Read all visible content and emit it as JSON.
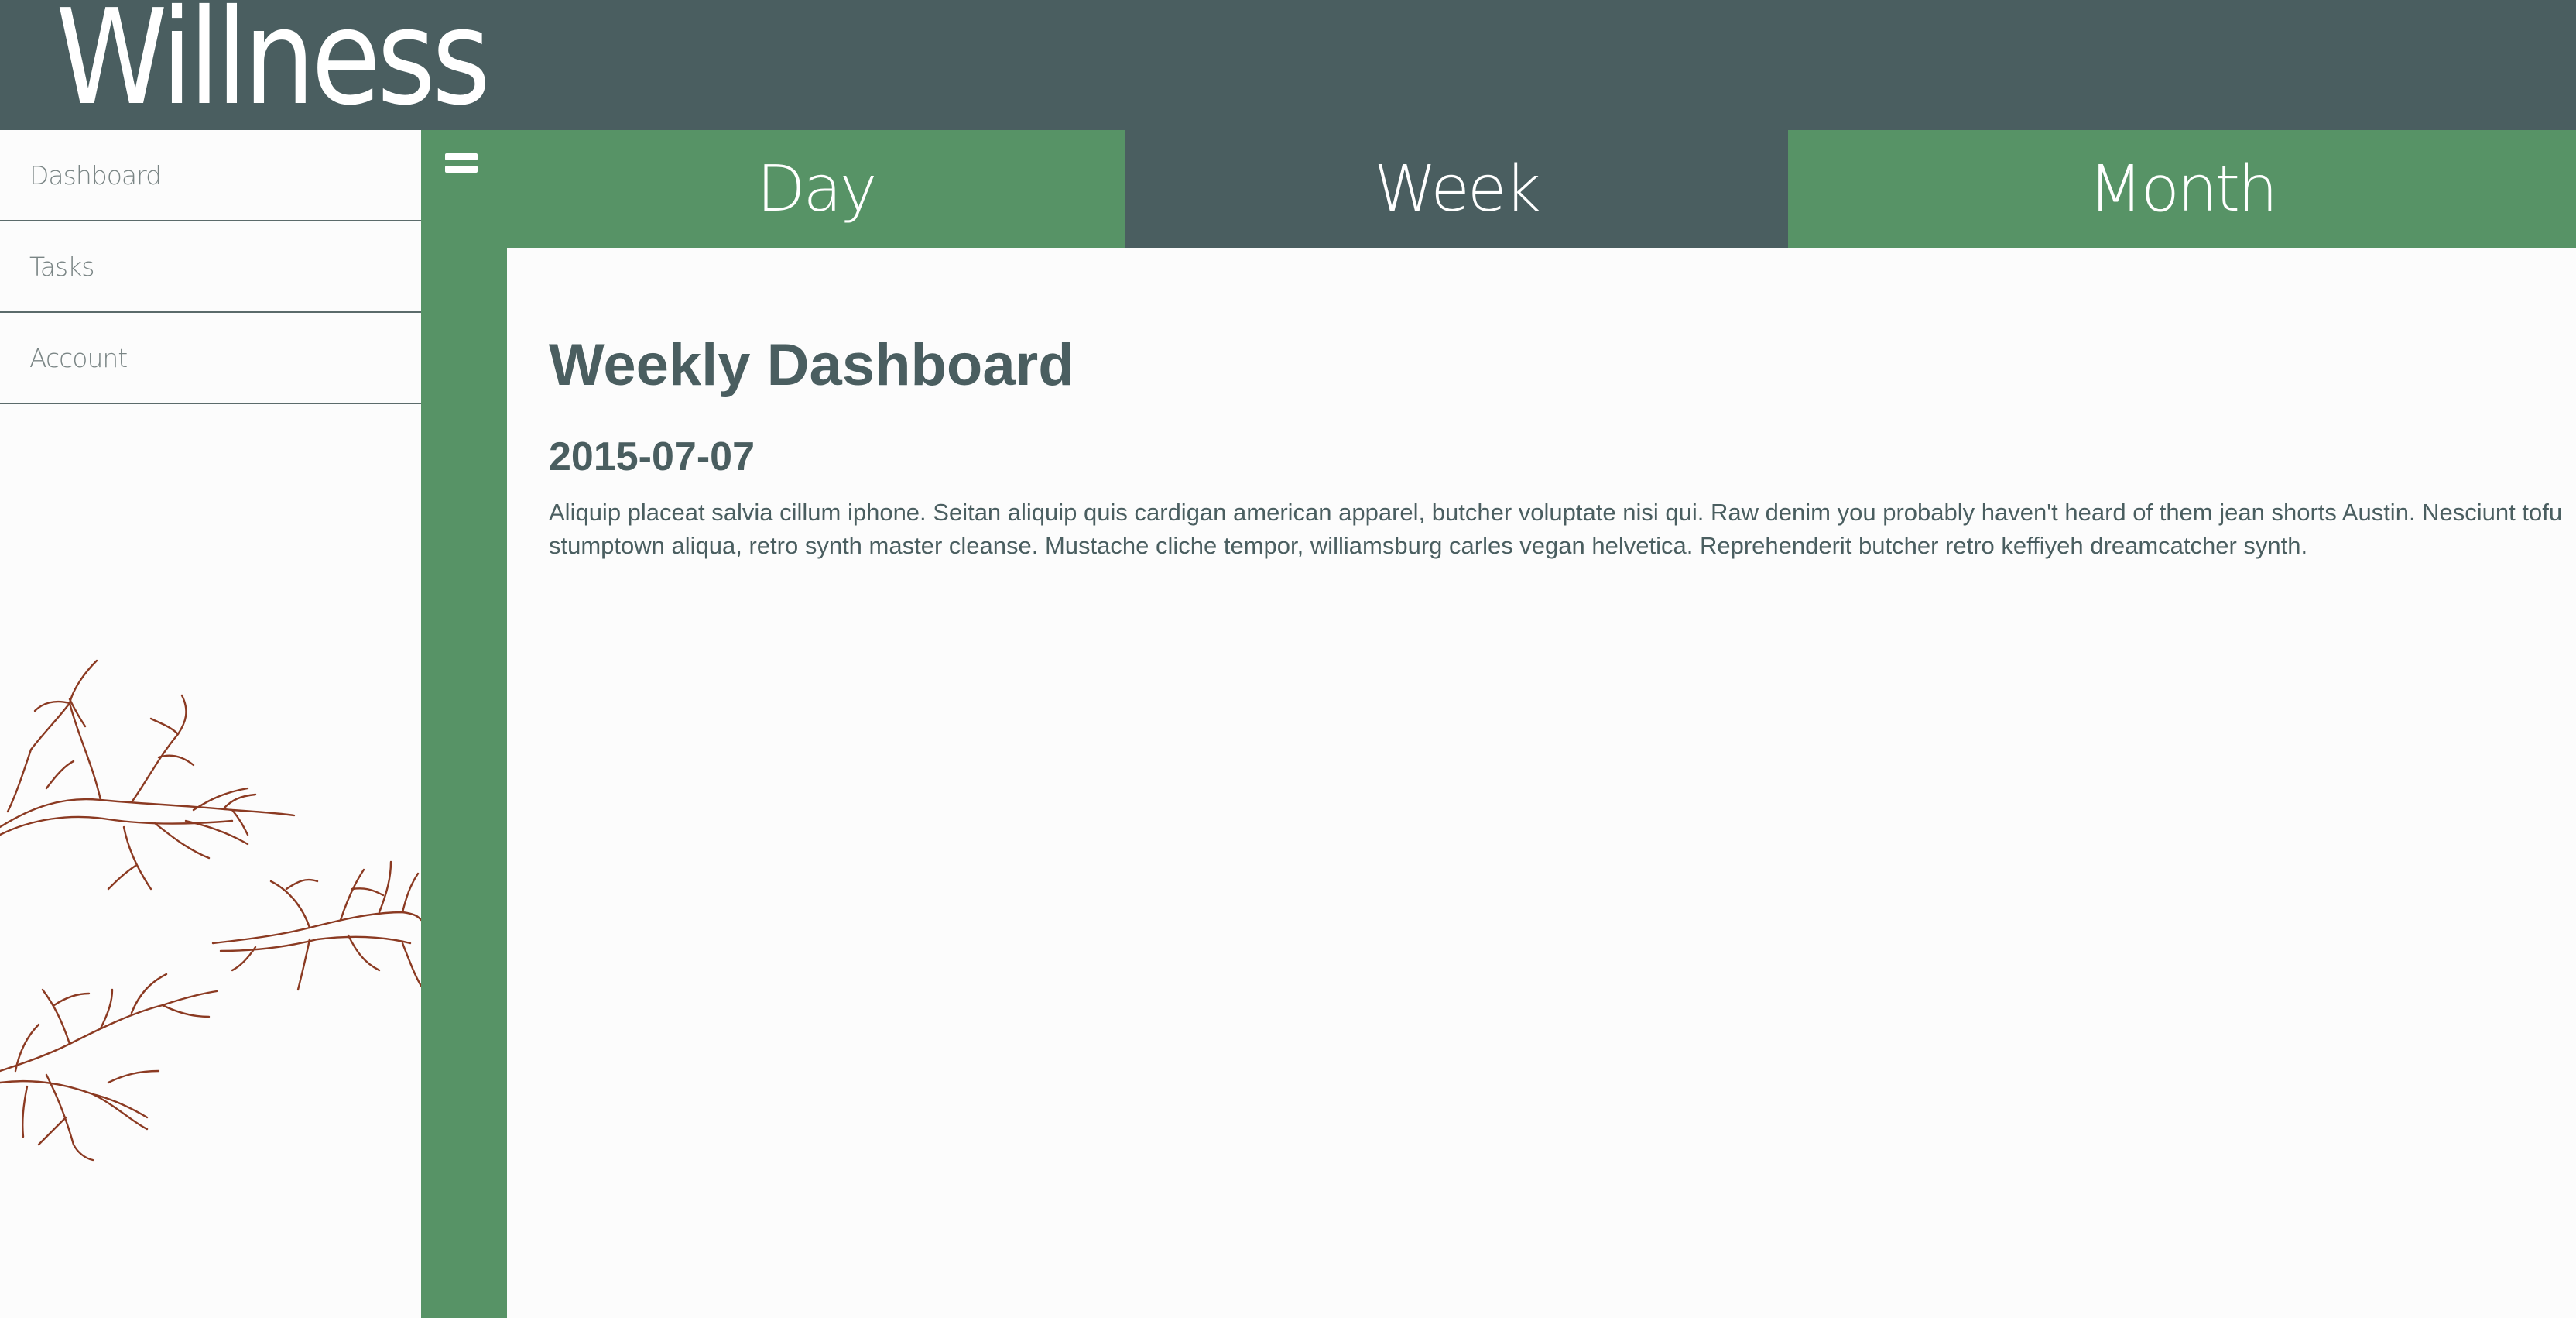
{
  "app": {
    "logo": "Willness"
  },
  "sidebar": {
    "items": [
      {
        "label": "Dashboard"
      },
      {
        "label": "Tasks"
      },
      {
        "label": "Account"
      }
    ]
  },
  "tabs": [
    {
      "label": "Day",
      "active": false
    },
    {
      "label": "Week",
      "active": true
    },
    {
      "label": "Month",
      "active": false
    }
  ],
  "main": {
    "title": "Weekly Dashboard",
    "date": "2015-07-07",
    "body": "Aliquip placeat salvia cillum iphone. Seitan aliquip quis cardigan american apparel, butcher voluptate nisi qui. Raw denim you probably haven't heard of them jean shorts Austin. Nesciunt tofu stumptown aliqua, retro synth master cleanse. Mustache cliche tempor, williamsburg carles vegan helvetica. Reprehenderit butcher retro keffiyeh dreamcatcher synth."
  },
  "colors": {
    "header": "#4a5e60",
    "green": "#579366",
    "branch": "#8b3a22",
    "text": "#4a5e60"
  },
  "icons": {
    "menu": "hamburger-menu-icon",
    "decoration": "tree-branch-illustration"
  }
}
